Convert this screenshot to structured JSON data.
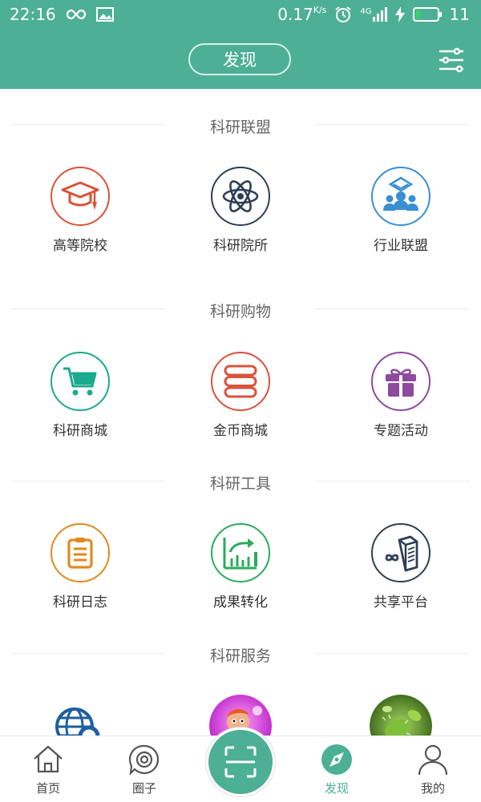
{
  "status_bar": {
    "time": "22:16",
    "speed": "0.17",
    "speed_unit": "K/s",
    "network": "4G",
    "battery": "11"
  },
  "header": {
    "title": "发现"
  },
  "colors": {
    "primary": "#4db096"
  },
  "sections": [
    {
      "title": "科研联盟",
      "items": [
        {
          "label": "高等院校",
          "icon": "graduation-cap-icon",
          "color": "#d9533b"
        },
        {
          "label": "科研院所",
          "icon": "atom-icon",
          "color": "#2e3f55"
        },
        {
          "label": "行业联盟",
          "icon": "alliance-people-icon",
          "color": "#3a8fd4"
        }
      ]
    },
    {
      "title": "科研购物",
      "items": [
        {
          "label": "科研商城",
          "icon": "shopping-cart-icon",
          "color": "#1aaa8c"
        },
        {
          "label": "金币商城",
          "icon": "coin-stack-icon",
          "color": "#d9533b"
        },
        {
          "label": "专题活动",
          "icon": "gift-icon",
          "color": "#8e4a9e"
        }
      ]
    },
    {
      "title": "科研工具",
      "items": [
        {
          "label": "科研日志",
          "icon": "clipboard-icon",
          "color": "#e08a1e"
        },
        {
          "label": "成果转化",
          "icon": "chart-export-icon",
          "color": "#2bab5c"
        },
        {
          "label": "共享平台",
          "icon": "server-share-icon",
          "color": "#2e3f55"
        }
      ]
    },
    {
      "title": "科研服务",
      "items": [
        {
          "label": "",
          "icon": "globe-search-icon"
        },
        {
          "label": "",
          "icon": "cartoon-photo"
        },
        {
          "label": "",
          "icon": "microbe-photo"
        }
      ]
    }
  ],
  "tabbar": {
    "items": [
      {
        "label": "首页",
        "icon": "home-icon"
      },
      {
        "label": "圈子",
        "icon": "circle-icon"
      },
      {
        "label": "发现",
        "icon": "compass-icon",
        "active": true
      },
      {
        "label": "我的",
        "icon": "user-icon"
      }
    ],
    "scan_icon": "scan-icon"
  }
}
